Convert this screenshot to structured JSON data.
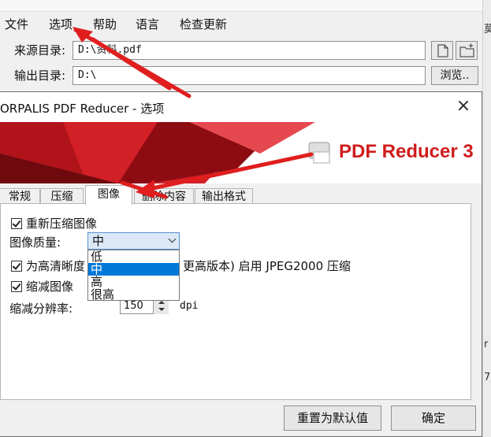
{
  "menu": [
    "文件",
    "选项",
    "帮助",
    "语言",
    "检查更新"
  ],
  "source": {
    "label": "来源目录:",
    "value": "D:\\资料.pdf"
  },
  "output": {
    "label": "输出目录:",
    "value": "D:\\",
    "browse": "浏览.."
  },
  "right_edge_fragments": [
    "莫",
    "r",
    "7"
  ],
  "dialog": {
    "title": "ORPALIS PDF Reducer - 选项",
    "close": "×",
    "brand_pdf": "PDF Reducer",
    "brand_num": "3",
    "tabs": [
      "常规",
      "压缩",
      "图像",
      "删除内容",
      "输出格式"
    ],
    "recompress_label": "重新压缩图像",
    "quality_label": "图像质量:",
    "quality_value": "中",
    "quality_options": [
      "低",
      "中",
      "高",
      "很高"
    ],
    "jpeg2000_prefix": "为高清晰度",
    "jpeg2000_suffix": "更高版本) 启用 JPEG2000 压缩",
    "downsample_label": "缩减图像",
    "resolution_label": "缩减分辨率:",
    "resolution_value": "150",
    "resolution_unit": "dpi",
    "reset_button": "重置为默认值",
    "ok_button": "确定"
  },
  "colors": {
    "brand_red": "#d01c1c",
    "selection": "#0078d7",
    "arrow_red": "#e01e1e"
  }
}
